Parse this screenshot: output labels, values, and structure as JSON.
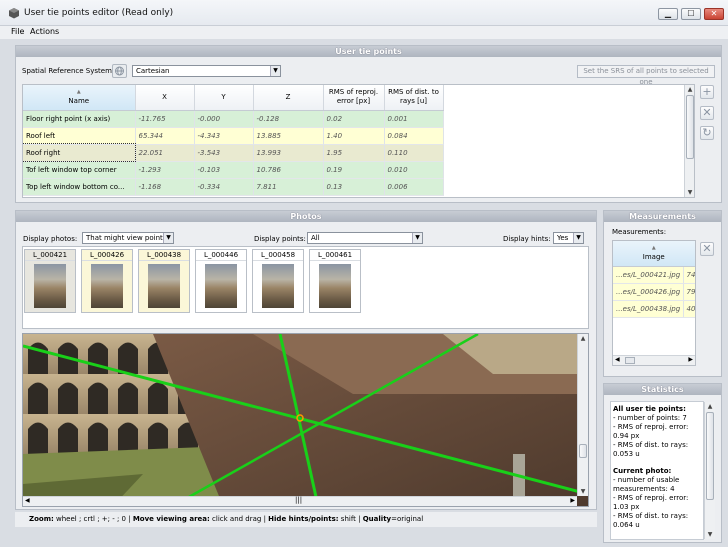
{
  "window": {
    "title": "User tie points editor (Read only)",
    "minimize": "▁",
    "maximize": "☐",
    "close": "✕"
  },
  "menu": {
    "file": "File",
    "actions": "Actions"
  },
  "tiepoints": {
    "panel_title": "User tie points",
    "srs_label": "Spatial Reference System",
    "srs_value": "Cartesian",
    "set_srs_button": "Set the SRS of all points to selected one",
    "columns": [
      "Name",
      "X",
      "Y",
      "Z",
      "RMS of reproj. error [px]",
      "RMS of dist. to rays [u]"
    ],
    "rows": [
      {
        "name": "Floor right point (x axis)",
        "x": "-11.765",
        "y": "-0.000",
        "z": "-0.128",
        "rms_px": "0.02",
        "rms_u": "0.001",
        "color": "#d7f0d7"
      },
      {
        "name": "Roof left",
        "x": "65.344",
        "y": "-4.343",
        "z": "13.885",
        "rms_px": "1.40",
        "rms_u": "0.084",
        "color": "#ffffd4"
      },
      {
        "name": "Roof right",
        "x": "22.051",
        "y": "-3.543",
        "z": "13.993",
        "rms_px": "1.95",
        "rms_u": "0.110",
        "color": "#e9ead0"
      },
      {
        "name": "Tof left window top corner",
        "x": "-1.293",
        "y": "-0.103",
        "z": "10.786",
        "rms_px": "0.19",
        "rms_u": "0.010",
        "color": "#d7f0d7"
      },
      {
        "name": "Top left window bottom co...",
        "x": "-1.168",
        "y": "-0.334",
        "z": "7.811",
        "rms_px": "0.13",
        "rms_u": "0.006",
        "color": "#d7f0d7"
      }
    ]
  },
  "photos": {
    "panel_title": "Photos",
    "display_photos_label": "Display photos:",
    "display_photos_value": "That might view point",
    "display_points_label": "Display points:",
    "display_points_value": "All",
    "display_hints_label": "Display hints:",
    "display_hints_value": "Yes",
    "thumbs": [
      "L_000421",
      "L_000426",
      "L_000438",
      "L_000446",
      "L_000458",
      "L_000461"
    ],
    "thumb_backgrounds": [
      "#e7e6df",
      "#fbf7d8",
      "#fbf7d8",
      "#ffffff",
      "#ffffff",
      "#ffffff"
    ]
  },
  "measurements": {
    "panel_title": "Measurements",
    "label": "Measurements:",
    "column": "Image",
    "rows": [
      {
        "image": "...es/L_000421.jpg",
        "value": "74"
      },
      {
        "image": "...es/L_000426.jpg",
        "value": "79"
      },
      {
        "image": "...es/L_000438.jpg",
        "value": "40"
      }
    ]
  },
  "statistics": {
    "panel_title": "Statistics",
    "all_heading": "All user tie points:",
    "all_lines": [
      "- number of points: 7",
      "- RMS of reproj. error:",
      "0.94 px",
      "- RMS of dist. to rays:",
      "0.053 u"
    ],
    "current_heading": "Current photo:",
    "current_lines": [
      "- number of usable",
      "measurements: 4",
      "- RMS of reproj. error:",
      "1.03 px",
      "- RMS of dist. to rays:",
      "0.064 u"
    ]
  },
  "status": {
    "zoom_label": "Zoom:",
    "zoom_text": " wheel ; crtl ; +; - ; 0 | ",
    "move_label": "Move viewing area:",
    "move_text": " click and drag | ",
    "hide_label": "Hide hints/points:",
    "hide_text": " shift | ",
    "quality_label": "Quality",
    "quality_text": "=original"
  },
  "colors": {
    "hint_line": "#19d019",
    "header_gradient": "#aeb5bf"
  },
  "icons": {
    "app": "cube-icon",
    "add": "plus-icon",
    "delete": "x-icon",
    "refresh": "refresh-icon",
    "srs": "globe-icon"
  }
}
